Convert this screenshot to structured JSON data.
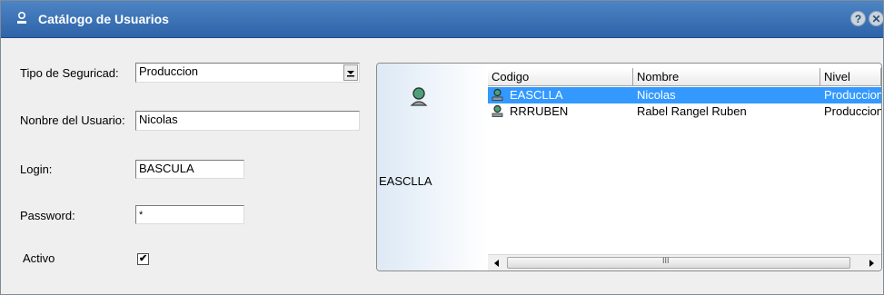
{
  "window": {
    "title": "Catálogo de Usuarios",
    "help_label": "?",
    "close_label": "✕"
  },
  "form": {
    "security_type_label": "Tipo de Seguricad:",
    "security_type_value": "Produccion",
    "username_label": "Nonbre del Usuario:",
    "username_value": "Nicolas",
    "login_label": "Login:",
    "login_value": "BASCULA",
    "password_label": "Password:",
    "password_value": "*",
    "active_label": "Activo",
    "active_checked": true,
    "active_mark": "✔"
  },
  "card": {
    "code": "EASCLLA"
  },
  "list": {
    "columns": [
      "Codigo",
      "Nombre",
      "Nivel"
    ],
    "rows": [
      {
        "code": "EASCLLA",
        "name": "Nicolas",
        "level": "Produccion",
        "selected": true
      },
      {
        "code": "RRRUBEN",
        "name": "Rabel Rangel Ruben",
        "level": "Produccion",
        "selected": false
      }
    ],
    "scroll_grip": "III"
  },
  "colors": {
    "titlebar": "#3a72b8",
    "selection": "#3399ff",
    "window_bg": "#efefef"
  },
  "icons": {
    "title": "user-icon",
    "card": "user-avatar-icon",
    "row": "user-icon"
  }
}
